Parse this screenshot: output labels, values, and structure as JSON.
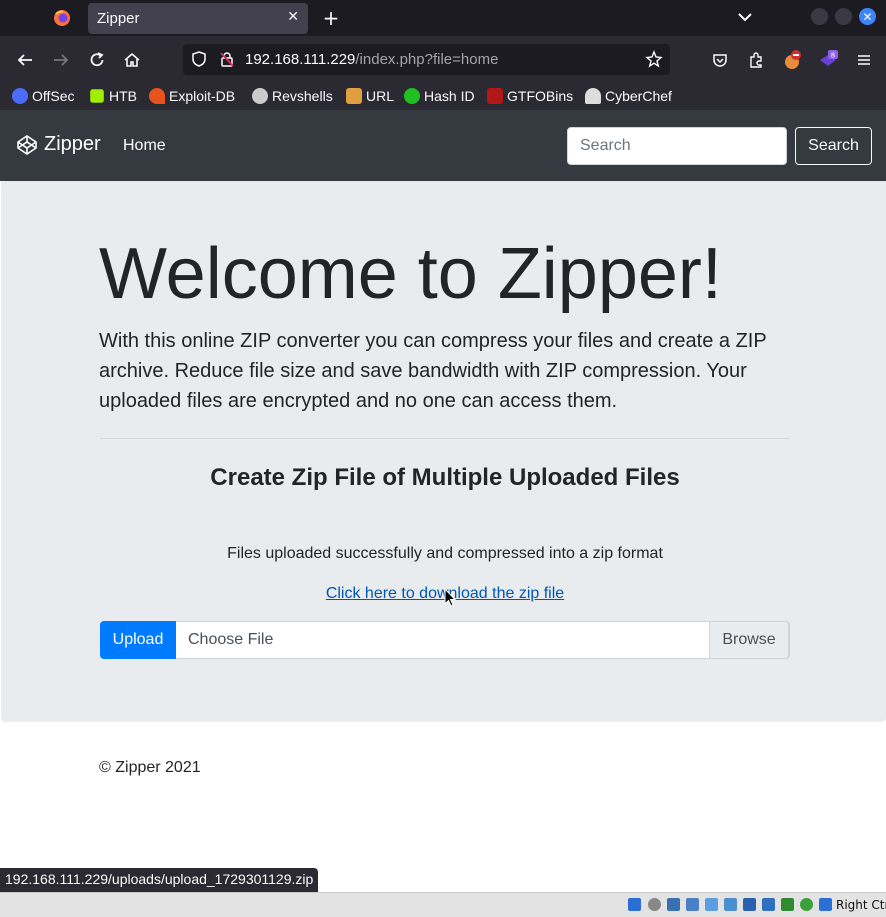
{
  "browser": {
    "tab_title": "Zipper",
    "new_tab_label": "+",
    "close_tab_label": "✕",
    "url_host": "192.168.111.229",
    "url_path": "/index.php?file=home"
  },
  "bookmarks": [
    {
      "label": "OffSec",
      "color": "#4a6cf7"
    },
    {
      "label": "HTB",
      "color": "#9fef00"
    },
    {
      "label": "Exploit-DB",
      "color": "#e8521c"
    },
    {
      "label": "Revshells",
      "color": "#cccccc"
    },
    {
      "label": "URL",
      "color": "#e0a040"
    },
    {
      "label": "Hash ID",
      "color": "#20c020"
    },
    {
      "label": "GTFOBins",
      "color": "#b01818"
    },
    {
      "label": "CyberChef",
      "color": "#dddddd"
    }
  ],
  "site": {
    "brand": "Zipper",
    "nav_home": "Home",
    "search_placeholder": "Search",
    "search_button": "Search",
    "heading": "Welcome to Zipper!",
    "lead": "With this online ZIP converter you can compress your files and create a ZIP archive. Reduce file size and save bandwidth with ZIP compression. Your uploaded files are encrypted and no one can access them.",
    "section_title": "Create Zip File of Multiple Uploaded Files",
    "success_message": "Files uploaded successfully and compressed into a zip format",
    "download_link": "Click here to download the zip file",
    "upload_button": "Upload",
    "file_placeholder": "Choose File",
    "browse_label": "Browse",
    "footer": "© Zipper 2021"
  },
  "status_bar": {
    "hover_url": "192.168.111.229/uploads/upload_1729301129.zip"
  },
  "vm_bar": {
    "host_key": "Right Ctrl"
  }
}
